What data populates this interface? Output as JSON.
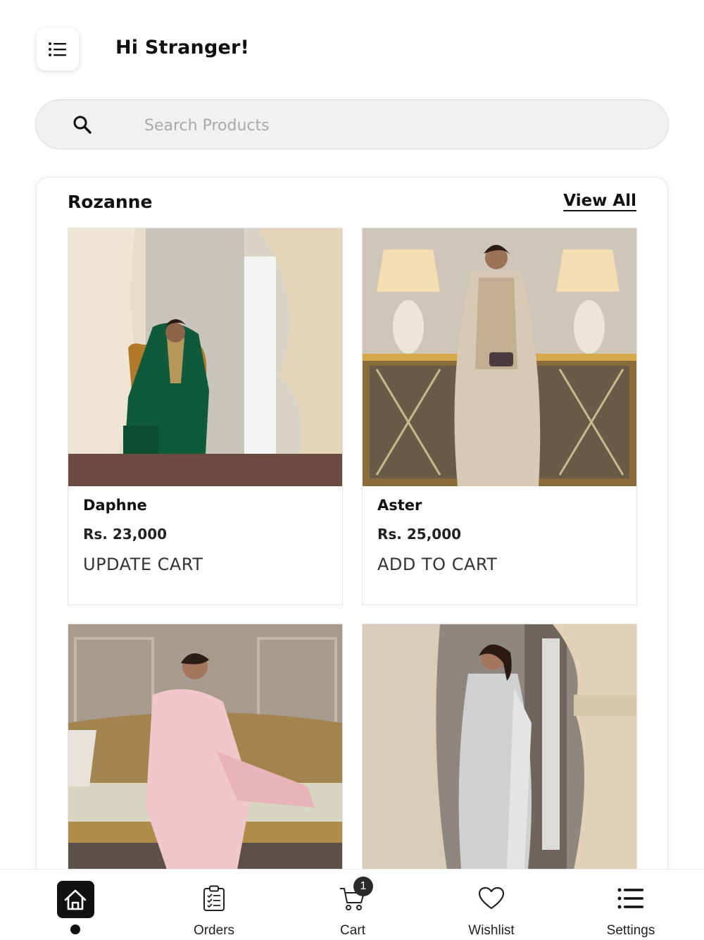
{
  "header": {
    "greeting": "Hi Stranger!",
    "menu_icon": "list-menu-icon"
  },
  "search": {
    "placeholder": "Search Products",
    "value": ""
  },
  "section": {
    "title": "Rozanne",
    "view_all": "View All"
  },
  "products": [
    {
      "name": "Daphne",
      "price": "Rs. 23,000",
      "action": "UPDATE CART"
    },
    {
      "name": "Aster",
      "price": "Rs. 25,000",
      "action": "ADD TO CART"
    },
    {
      "name": "",
      "price": "",
      "action": ""
    },
    {
      "name": "",
      "price": "",
      "action": ""
    }
  ],
  "nav": {
    "items": [
      {
        "label": "",
        "icon": "home-icon",
        "active": true
      },
      {
        "label": "Orders",
        "icon": "clipboard-icon"
      },
      {
        "label": "Cart",
        "icon": "cart-icon",
        "badge": "1"
      },
      {
        "label": "Wishlist",
        "icon": "heart-icon"
      },
      {
        "label": "Settings",
        "icon": "list-icon"
      }
    ]
  },
  "colors": {
    "primary": "#111111",
    "search_bg": "#f1f1f1",
    "badge_bg": "#2b2b2b"
  }
}
